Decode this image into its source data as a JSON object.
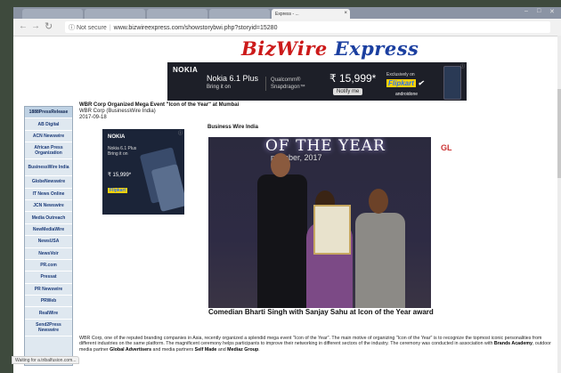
{
  "browser": {
    "tabs": [
      {
        "label": "",
        "active": false
      },
      {
        "label": "",
        "active": false
      },
      {
        "label": "",
        "active": false
      },
      {
        "label": "",
        "active": false
      },
      {
        "label": "Express - ...",
        "active": true
      }
    ],
    "not_secure": "Not secure",
    "url": "www.bizwireexpress.com/showstorybwi.php?storyid=15280",
    "status_text": "Waiting for a.tribalfusion.com..."
  },
  "site": {
    "logo_part1": "BizWire",
    "logo_part2": "Express"
  },
  "ad_banner": {
    "brand": "NOKIA",
    "model": "Nokia 6.1 Plus",
    "tagline": "Bring it on",
    "chip_line1": "Qualcomm®",
    "chip_line2": "Snapdragon™",
    "price": "₹ 15,999*",
    "notify": "Notify me",
    "exclusive": "Exclusively on",
    "store": "Flipkart",
    "os": "androidone"
  },
  "ad_side": {
    "brand": "NOKIA",
    "model": "Nokia 6.1 Plus Bring it on",
    "price": "₹ 15,999*",
    "store": "Flipkart"
  },
  "sidebar": {
    "items": [
      {
        "label": "1888PressRelease",
        "top": true
      },
      {
        "label": "AB Digital"
      },
      {
        "label": "ACN Newswire"
      },
      {
        "label": "African Press Organization",
        "tall": true
      },
      {
        "label": "BusinessWire India",
        "tall": true
      },
      {
        "label": "GlobeNewswire"
      },
      {
        "label": "IT News Online"
      },
      {
        "label": "JCN Newswire"
      },
      {
        "label": "Media Outreach"
      },
      {
        "label": "NewMediaWire"
      },
      {
        "label": "NewsUSA"
      },
      {
        "label": "NewsVoir"
      },
      {
        "label": "PR.com"
      },
      {
        "label": "Pressat"
      },
      {
        "label": "PR Newswire"
      },
      {
        "label": "PRWeb"
      },
      {
        "label": "RealWire"
      },
      {
        "label": "Send2Press Newswire",
        "tall": true
      }
    ]
  },
  "article": {
    "title": "WBR Corp Organized Mega Event \"Icon of the Year\" at Mumbai",
    "source": "WBR Corp (BusinessWire India)",
    "date": "2017-09-18",
    "dateline": "Business Wire India",
    "photo_sign": "OF THE YEAR",
    "photo_sign2": "ptember, 2017",
    "photo_gl": "GL",
    "photo_right": "GL",
    "caption": "Comedian Bharti Singh with Sanjay Sahu at Icon of the Year award",
    "para1": "WBR Corp, one of the reputed branding companies in Asia, recently organized a splendid mega event \"Icon of the Year\". The main motive of organizing \"Icon of the Year\" is to recognize the topmost iconic personalities from different industries on the same platform. The magnificent ceremony helps participants to improve their networking in different sectors of the industry. The ceremony was conducted in association with ",
    "para1_b1": "Brands Academy",
    "para1_mid": ", outdoor media partner ",
    "para1_b2": "Global Advertisers",
    "para1_mid2": " and media partners ",
    "para1_b3": "Self Made",
    "para1_and": " and ",
    "para1_b4": "Mediaz Group",
    "para1_end": "."
  }
}
